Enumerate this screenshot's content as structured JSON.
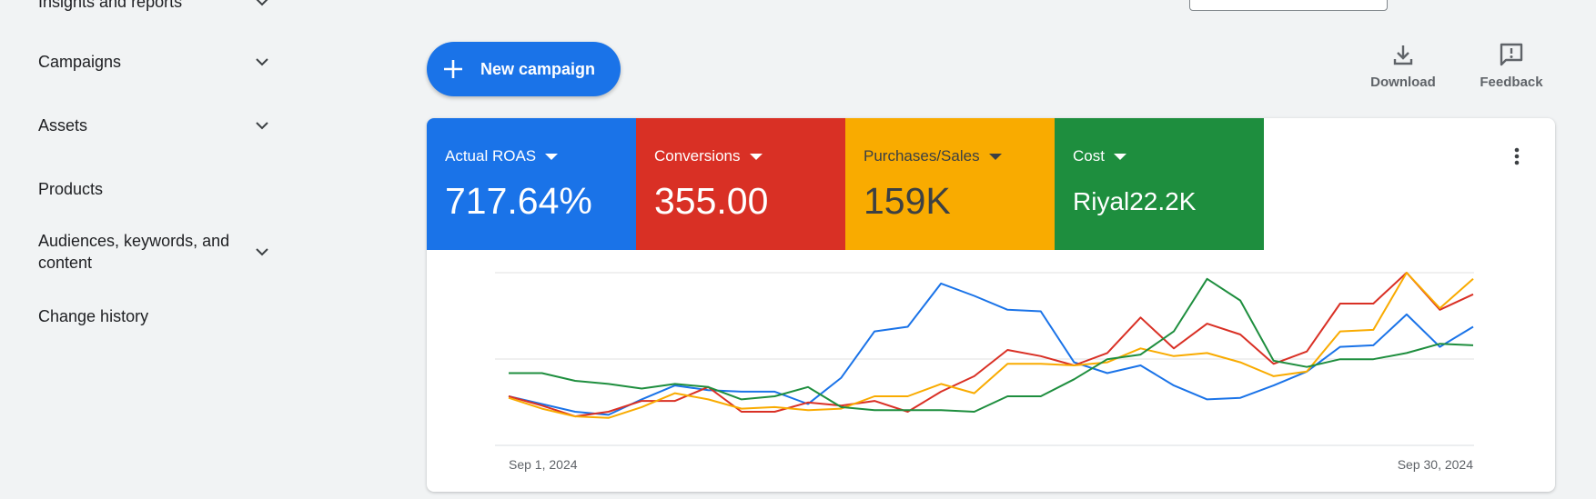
{
  "sidebar": {
    "items": [
      {
        "label": "Insights and reports",
        "has_chevron": true
      },
      {
        "label": "Campaigns",
        "has_chevron": true
      },
      {
        "label": "Assets",
        "has_chevron": true
      },
      {
        "label": "Products",
        "has_chevron": false
      },
      {
        "label": "Audiences, keywords, and content",
        "has_chevron": true
      },
      {
        "label": "Change history",
        "has_chevron": false
      }
    ]
  },
  "toolbar": {
    "new_campaign_label": "New campaign",
    "download_label": "Download",
    "feedback_label": "Feedback"
  },
  "metrics": [
    {
      "label": "Actual ROAS",
      "value": "717.64%",
      "color": "#1a73e8"
    },
    {
      "label": "Conversions",
      "value": "355.00",
      "color": "#d93025"
    },
    {
      "label": "Purchases/Sales",
      "value": "159K",
      "color": "#f9ab00"
    },
    {
      "label": "Cost",
      "value": "Riyal22.2K",
      "color": "#1e8e3e"
    }
  ],
  "chart_data": {
    "type": "line",
    "x_start_label": "Sep 1, 2024",
    "x_end_label": "Sep 30, 2024",
    "grid": true,
    "series": [
      {
        "color": "#1a73e8",
        "values": [
          0.2,
          0.15,
          0.1,
          0.08,
          0.18,
          0.27,
          0.24,
          0.23,
          0.23,
          0.15,
          0.32,
          0.62,
          0.65,
          0.93,
          0.85,
          0.76,
          0.75,
          0.42,
          0.35,
          0.4,
          0.27,
          0.18,
          0.19,
          0.27,
          0.36,
          0.52,
          0.53,
          0.73,
          0.52,
          0.65
        ]
      },
      {
        "color": "#d93025",
        "values": [
          0.2,
          0.14,
          0.07,
          0.1,
          0.17,
          0.17,
          0.26,
          0.1,
          0.1,
          0.16,
          0.14,
          0.17,
          0.1,
          0.23,
          0.33,
          0.5,
          0.46,
          0.4,
          0.48,
          0.71,
          0.51,
          0.67,
          0.6,
          0.41,
          0.49,
          0.8,
          0.8,
          1.0,
          0.76,
          0.86
        ]
      },
      {
        "color": "#f9ab00",
        "values": [
          0.19,
          0.12,
          0.07,
          0.06,
          0.13,
          0.22,
          0.18,
          0.12,
          0.13,
          0.11,
          0.12,
          0.2,
          0.2,
          0.28,
          0.22,
          0.41,
          0.41,
          0.4,
          0.42,
          0.51,
          0.46,
          0.48,
          0.42,
          0.33,
          0.36,
          0.62,
          0.63,
          1.0,
          0.77,
          0.96
        ]
      },
      {
        "color": "#1e8e3e",
        "values": [
          0.35,
          0.35,
          0.3,
          0.28,
          0.25,
          0.28,
          0.26,
          0.18,
          0.2,
          0.26,
          0.13,
          0.11,
          0.11,
          0.11,
          0.1,
          0.2,
          0.2,
          0.31,
          0.44,
          0.47,
          0.62,
          0.96,
          0.82,
          0.43,
          0.39,
          0.44,
          0.44,
          0.48,
          0.54,
          0.53
        ]
      }
    ]
  }
}
